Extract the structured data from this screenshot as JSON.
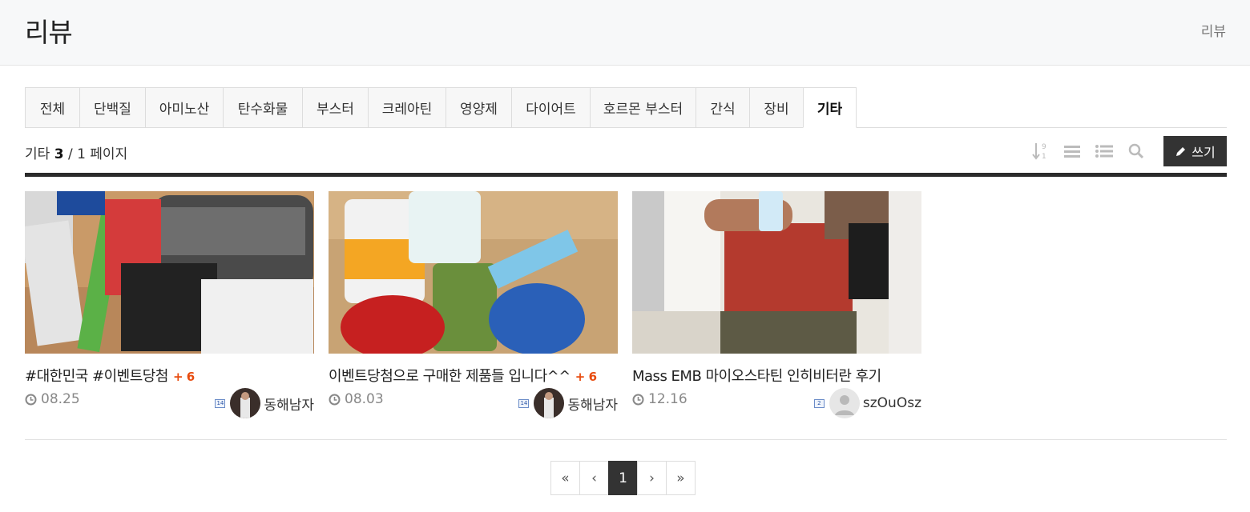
{
  "header": {
    "title": "리뷰",
    "breadcrumb": "리뷰"
  },
  "tabs": [
    "전체",
    "단백질",
    "아미노산",
    "탄수화물",
    "부스터",
    "크레아틴",
    "영양제",
    "다이어트",
    "호르몬 부스터",
    "간식",
    "장비",
    "기타"
  ],
  "active_tab": "기타",
  "info": {
    "category": "기타",
    "count": "3",
    "page_text": "/ 1 페이지"
  },
  "toolbar": {
    "write_label": "쓰기"
  },
  "posts": [
    {
      "title": "#대한민국 #이벤트당첨",
      "comments": "+ 6",
      "date": "08.25",
      "level": "14",
      "author": "동해남자"
    },
    {
      "title": "이벤트당첨으로 구매한 제품들 입니다^^",
      "comments": "+ 6",
      "date": "08.03",
      "level": "14",
      "author": "동해남자"
    },
    {
      "title": "Mass EMB 마이오스타틴 인히비터란 후기",
      "comments": "",
      "date": "12.16",
      "level": "2",
      "author": "szOuOsz"
    }
  ],
  "pagination": {
    "first": "«",
    "prev": "‹",
    "current": "1",
    "next": "›",
    "last": "»"
  },
  "colors": {
    "accent_comment": "#e84c0f",
    "dark": "#333333"
  }
}
